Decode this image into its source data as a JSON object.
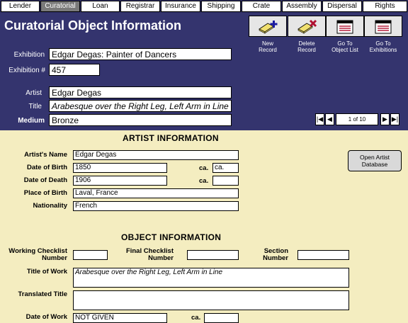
{
  "tabs": [
    {
      "label": "Lender",
      "active": false
    },
    {
      "label": "Curatorial",
      "active": true
    },
    {
      "label": "Loan",
      "active": false
    },
    {
      "label": "Registrar",
      "active": false
    },
    {
      "label": "Insurance",
      "active": false
    },
    {
      "label": "Shipping",
      "active": false
    },
    {
      "label": "Crate",
      "active": false
    },
    {
      "label": "Assembly",
      "active": false
    },
    {
      "label": "Dispersal",
      "active": false
    },
    {
      "label": "Rights",
      "active": false
    }
  ],
  "header": {
    "title": "Curatorial Object Information",
    "exhibition_label": "Exhibition",
    "exhibition_value": "Edgar Degas: Painter of Dancers",
    "exhibition_num_label": "Exhibition #",
    "exhibition_num_value": "457",
    "artist_label": "Artist",
    "artist_value": "Edgar Degas",
    "title_label": "Title",
    "title_value": "Arabesque over the Right Leg, Left Arm in Line",
    "medium_label": "Medium",
    "medium_value": "Bronze"
  },
  "toolbar": [
    {
      "label1": "New",
      "label2": "Record",
      "icon": "new-record-icon"
    },
    {
      "label1": "Delete",
      "label2": "Record",
      "icon": "delete-record-icon"
    },
    {
      "label1": "Go To",
      "label2": "Object List",
      "icon": "object-list-icon"
    },
    {
      "label1": "Go To",
      "label2": "Exhibitions",
      "icon": "exhibitions-icon"
    }
  ],
  "nav": {
    "first": "|◀",
    "prev": "◀",
    "record": "1 of 10",
    "next": "▶",
    "last": "▶|"
  },
  "artist_section": {
    "heading": "ARTIST INFORMATION",
    "name_label": "Artist's Name",
    "name_value": "Edgar Degas",
    "dob_label": "Date of Birth",
    "dob_value": "1850",
    "ca_label": "ca.",
    "dob_ca_value": "ca.",
    "dod_label": "Date of Death",
    "dod_value": "1906",
    "dod_ca_value": "",
    "pob_label": "Place of Birth",
    "pob_value": "Laval, France",
    "nationality_label": "Nationality",
    "nationality_value": "French",
    "open_db_line1": "Open Artist",
    "open_db_line2": "Database"
  },
  "object_section": {
    "heading": "OBJECT INFORMATION",
    "working_label1": "Working Checklist",
    "working_label2": "Number",
    "working_value": "",
    "final_label1": "Final Checklist",
    "final_label2": "Number",
    "final_value": "",
    "section_label1": "Section",
    "section_label2": "Number",
    "section_value": "",
    "title_label": "Title of Work",
    "title_value": "Arabesque over the Right Leg, Left Arm in Line",
    "translated_label": "Translated Title",
    "translated_value": "",
    "date_label": "Date of Work",
    "date_value": "NOT GIVEN",
    "date_ca_value": ""
  },
  "colors": {
    "header_bg": "#34346e",
    "body_bg": "#f4edc0",
    "active_tab": "#7a7a7a"
  }
}
